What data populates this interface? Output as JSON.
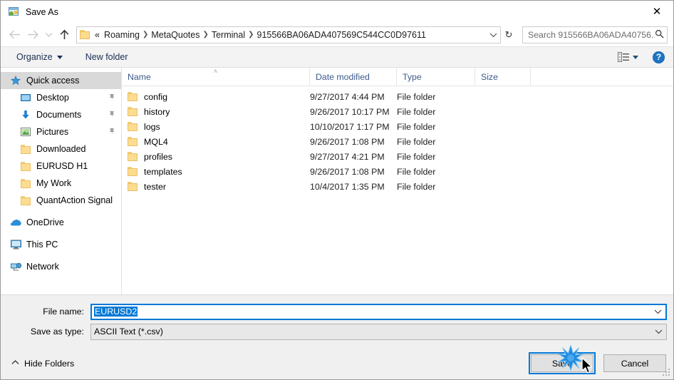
{
  "window": {
    "title": "Save As",
    "icon": "save-as-app-icon",
    "close_label": "✕"
  },
  "nav": {
    "back": "←",
    "forward": "→",
    "recent": "⌄",
    "up": "↑",
    "refresh": "↻",
    "address_caret": "⌄",
    "breadcrumb_prefix": "«",
    "breadcrumb": [
      "Roaming",
      "MetaQuotes",
      "Terminal",
      "915566BA06ADA407569C544CC0D97611"
    ],
    "separator": "❯"
  },
  "search": {
    "placeholder": "Search 915566BA06ADA40756...",
    "icon": "search-icon"
  },
  "toolbar": {
    "organize_label": "Organize",
    "new_folder_label": "New folder",
    "view_icon": "list-view-icon",
    "help_label": "?"
  },
  "sidebar": {
    "groups": [
      {
        "items": [
          {
            "label": "Quick access",
            "icon": "star-icon",
            "selected": true,
            "pinned": false,
            "indent": false
          },
          {
            "label": "Desktop",
            "icon": "desktop-icon",
            "selected": false,
            "pinned": true,
            "indent": true
          },
          {
            "label": "Documents",
            "icon": "documents-icon",
            "selected": false,
            "pinned": true,
            "indent": true
          },
          {
            "label": "Pictures",
            "icon": "pictures-icon",
            "selected": false,
            "pinned": true,
            "indent": true
          },
          {
            "label": "Downloaded",
            "icon": "folder-icon",
            "selected": false,
            "pinned": false,
            "indent": true
          },
          {
            "label": "EURUSD H1",
            "icon": "folder-icon",
            "selected": false,
            "pinned": false,
            "indent": true
          },
          {
            "label": "My Work",
            "icon": "folder-icon",
            "selected": false,
            "pinned": false,
            "indent": true
          },
          {
            "label": "QuantAction Signal",
            "icon": "folder-icon",
            "selected": false,
            "pinned": false,
            "indent": true
          }
        ]
      },
      {
        "items": [
          {
            "label": "OneDrive",
            "icon": "onedrive-cloud-icon",
            "selected": false,
            "pinned": false,
            "indent": false
          }
        ]
      },
      {
        "items": [
          {
            "label": "This PC",
            "icon": "this-pc-icon",
            "selected": false,
            "pinned": false,
            "indent": false
          }
        ]
      },
      {
        "items": [
          {
            "label": "Network",
            "icon": "network-icon",
            "selected": false,
            "pinned": false,
            "indent": false
          }
        ]
      }
    ]
  },
  "filelist": {
    "columns": {
      "name": "Name",
      "date_modified": "Date modified",
      "type": "Type",
      "size": "Size"
    },
    "sort": {
      "column": "Name",
      "direction": "ascending",
      "caret": "˄"
    },
    "rows": [
      {
        "name": "config",
        "date": "9/27/2017 4:44 PM",
        "type": "File folder",
        "size": ""
      },
      {
        "name": "history",
        "date": "9/26/2017 10:17 PM",
        "type": "File folder",
        "size": ""
      },
      {
        "name": "logs",
        "date": "10/10/2017 1:17 PM",
        "type": "File folder",
        "size": ""
      },
      {
        "name": "MQL4",
        "date": "9/26/2017 1:08 PM",
        "type": "File folder",
        "size": ""
      },
      {
        "name": "profiles",
        "date": "9/27/2017 4:21 PM",
        "type": "File folder",
        "size": ""
      },
      {
        "name": "templates",
        "date": "9/26/2017 1:08 PM",
        "type": "File folder",
        "size": ""
      },
      {
        "name": "tester",
        "date": "10/4/2017 1:35 PM",
        "type": "File folder",
        "size": ""
      }
    ]
  },
  "form": {
    "filename_label": "File name:",
    "filename_value": "EURUSD2",
    "filetype_label": "Save as type:",
    "filetype_value": "ASCII Text (*.csv)",
    "dropdown_caret": "⌄"
  },
  "footer": {
    "hide_folders_label": "Hide Folders",
    "hide_folders_chevron": "˄",
    "save_label": "Save",
    "cancel_label": "Cancel"
  },
  "colors": {
    "accent": "#0078d7",
    "folder": "#fcdd90",
    "header_text": "#3c5a8a",
    "toolbar_text": "#1b2f52",
    "selection": "#d9d9d9"
  }
}
